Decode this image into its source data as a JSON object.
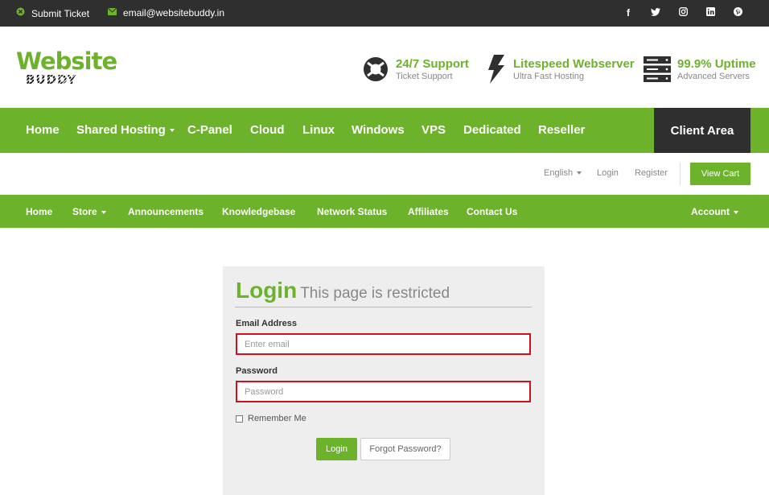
{
  "colors": {
    "accent": "#6cb22a",
    "dark": "#2f2f2f",
    "error_border": "#d0101f"
  },
  "topbar": {
    "ticket": {
      "icon": "close-circle-icon",
      "label": "Submit Ticket"
    },
    "email": {
      "icon": "envelope-icon",
      "label": "email@websitebuddy.in"
    },
    "social": [
      {
        "name": "facebook-icon",
        "glyph": "f"
      },
      {
        "name": "twitter-icon",
        "glyph": "t"
      },
      {
        "name": "instagram-icon",
        "glyph": "◎"
      },
      {
        "name": "linkedin-icon",
        "glyph": "in"
      },
      {
        "name": "pinterest-icon",
        "glyph": "P"
      }
    ]
  },
  "logo": {
    "line1": "Website",
    "line2": "BUDDY"
  },
  "features": [
    {
      "icon": "lifebuoy-icon",
      "title": "24/7 Support",
      "subtitle": "Ticket Support"
    },
    {
      "icon": "lightning-icon",
      "title": "Litespeed Webserver",
      "subtitle": "Ultra Fast Hosting"
    },
    {
      "icon": "server-icon",
      "title": "99.9% Uptime",
      "subtitle": "Advanced Servers"
    }
  ],
  "main_nav": {
    "items": [
      "Home",
      "Shared Hosting",
      "C-Panel",
      "Cloud",
      "Linux",
      "Windows",
      "VPS",
      "Dedicated",
      "Reseller"
    ],
    "client_area": "Client Area"
  },
  "utility": {
    "language": "English",
    "login": "Login",
    "register": "Register",
    "view_cart": "View Cart"
  },
  "sub_nav": {
    "items": [
      "Home",
      "Store",
      "Announcements",
      "Knowledgebase",
      "Network Status",
      "Affiliates",
      "Contact Us"
    ],
    "account": "Account"
  },
  "login_panel": {
    "title": "Login",
    "subtitle": "This page is restricted",
    "email_label": "Email Address",
    "email_placeholder": "Enter email",
    "password_label": "Password",
    "password_placeholder": "Password",
    "remember_label": "Remember Me",
    "login_button": "Login",
    "forgot_button": "Forgot Password?"
  }
}
